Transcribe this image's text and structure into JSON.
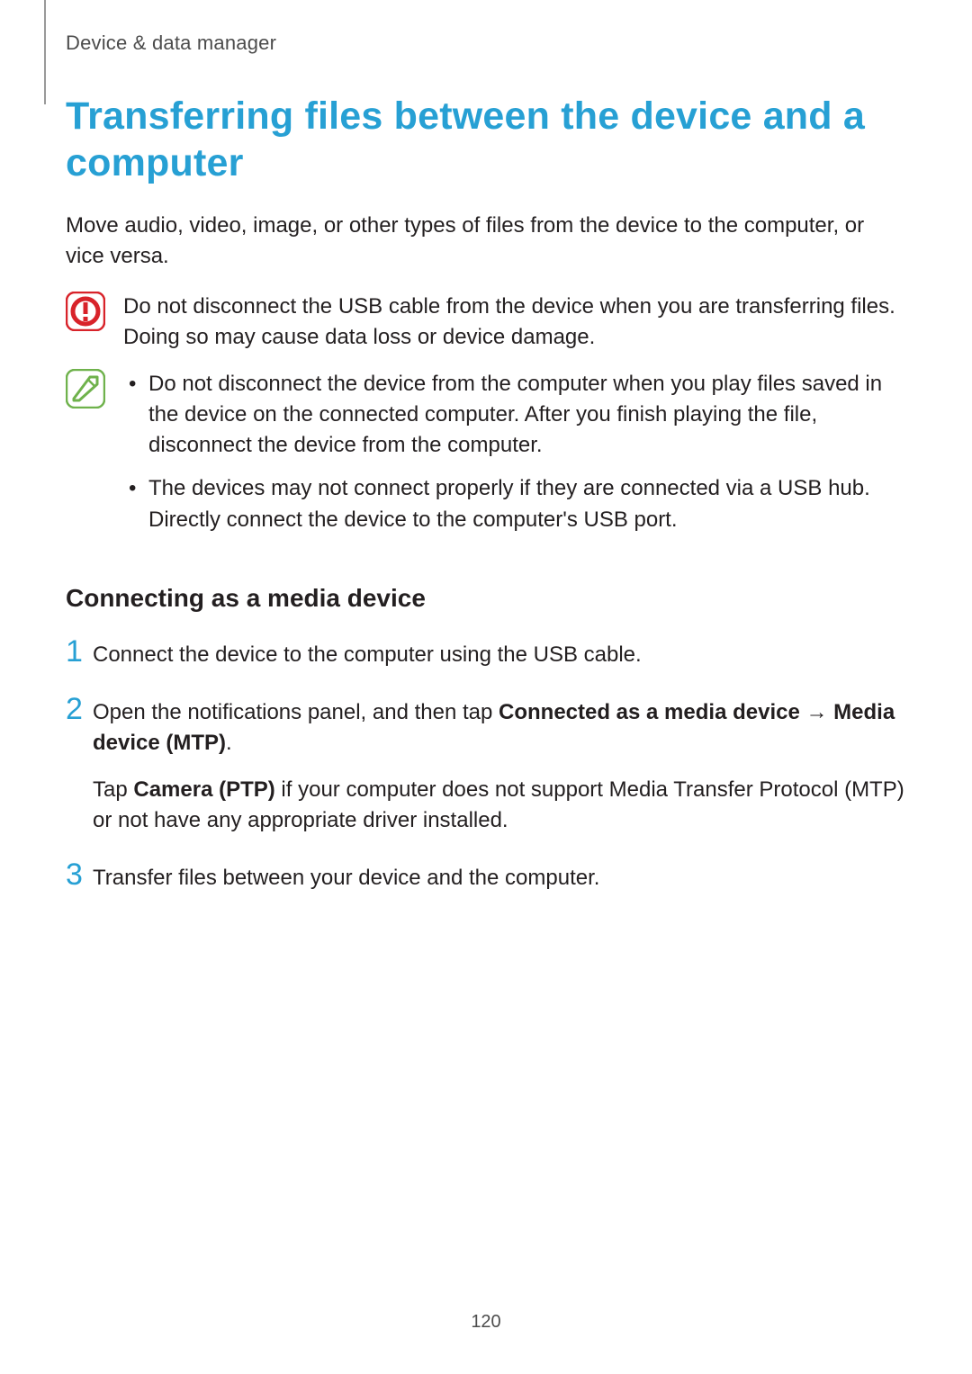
{
  "breadcrumb": "Device & data manager",
  "title": "Transferring files between the device and a computer",
  "intro": "Move audio, video, image, or other types of files from the device to the computer, or vice versa.",
  "warning": "Do not disconnect the USB cable from the device when you are transferring files. Doing so may cause data loss or device damage.",
  "notes": [
    "Do not disconnect the device from the computer when you play files saved in the device on the connected computer. After you finish playing the file, disconnect the device from the computer.",
    "The devices may not connect properly if they are connected via a USB hub. Directly connect the device to the computer's USB port."
  ],
  "subhead": "Connecting as a media device",
  "steps": {
    "s1": "Connect the device to the computer using the USB cable.",
    "s2": {
      "pre": "Open the notifications panel, and then tap ",
      "bold1": "Connected as a media device",
      "arrow": " → ",
      "bold2": "Media device (MTP)",
      "post": ".",
      "extra_pre": "Tap ",
      "extra_bold": "Camera (PTP)",
      "extra_post": " if your computer does not support Media Transfer Protocol (MTP) or not have any appropriate driver installed."
    },
    "s3": "Transfer files between your device and the computer."
  },
  "nums": {
    "n1": "1",
    "n2": "2",
    "n3": "3"
  },
  "page_number": "120",
  "colors": {
    "accent": "#27a0d4",
    "warn": "#d8232a",
    "note": "#6fb24c"
  }
}
